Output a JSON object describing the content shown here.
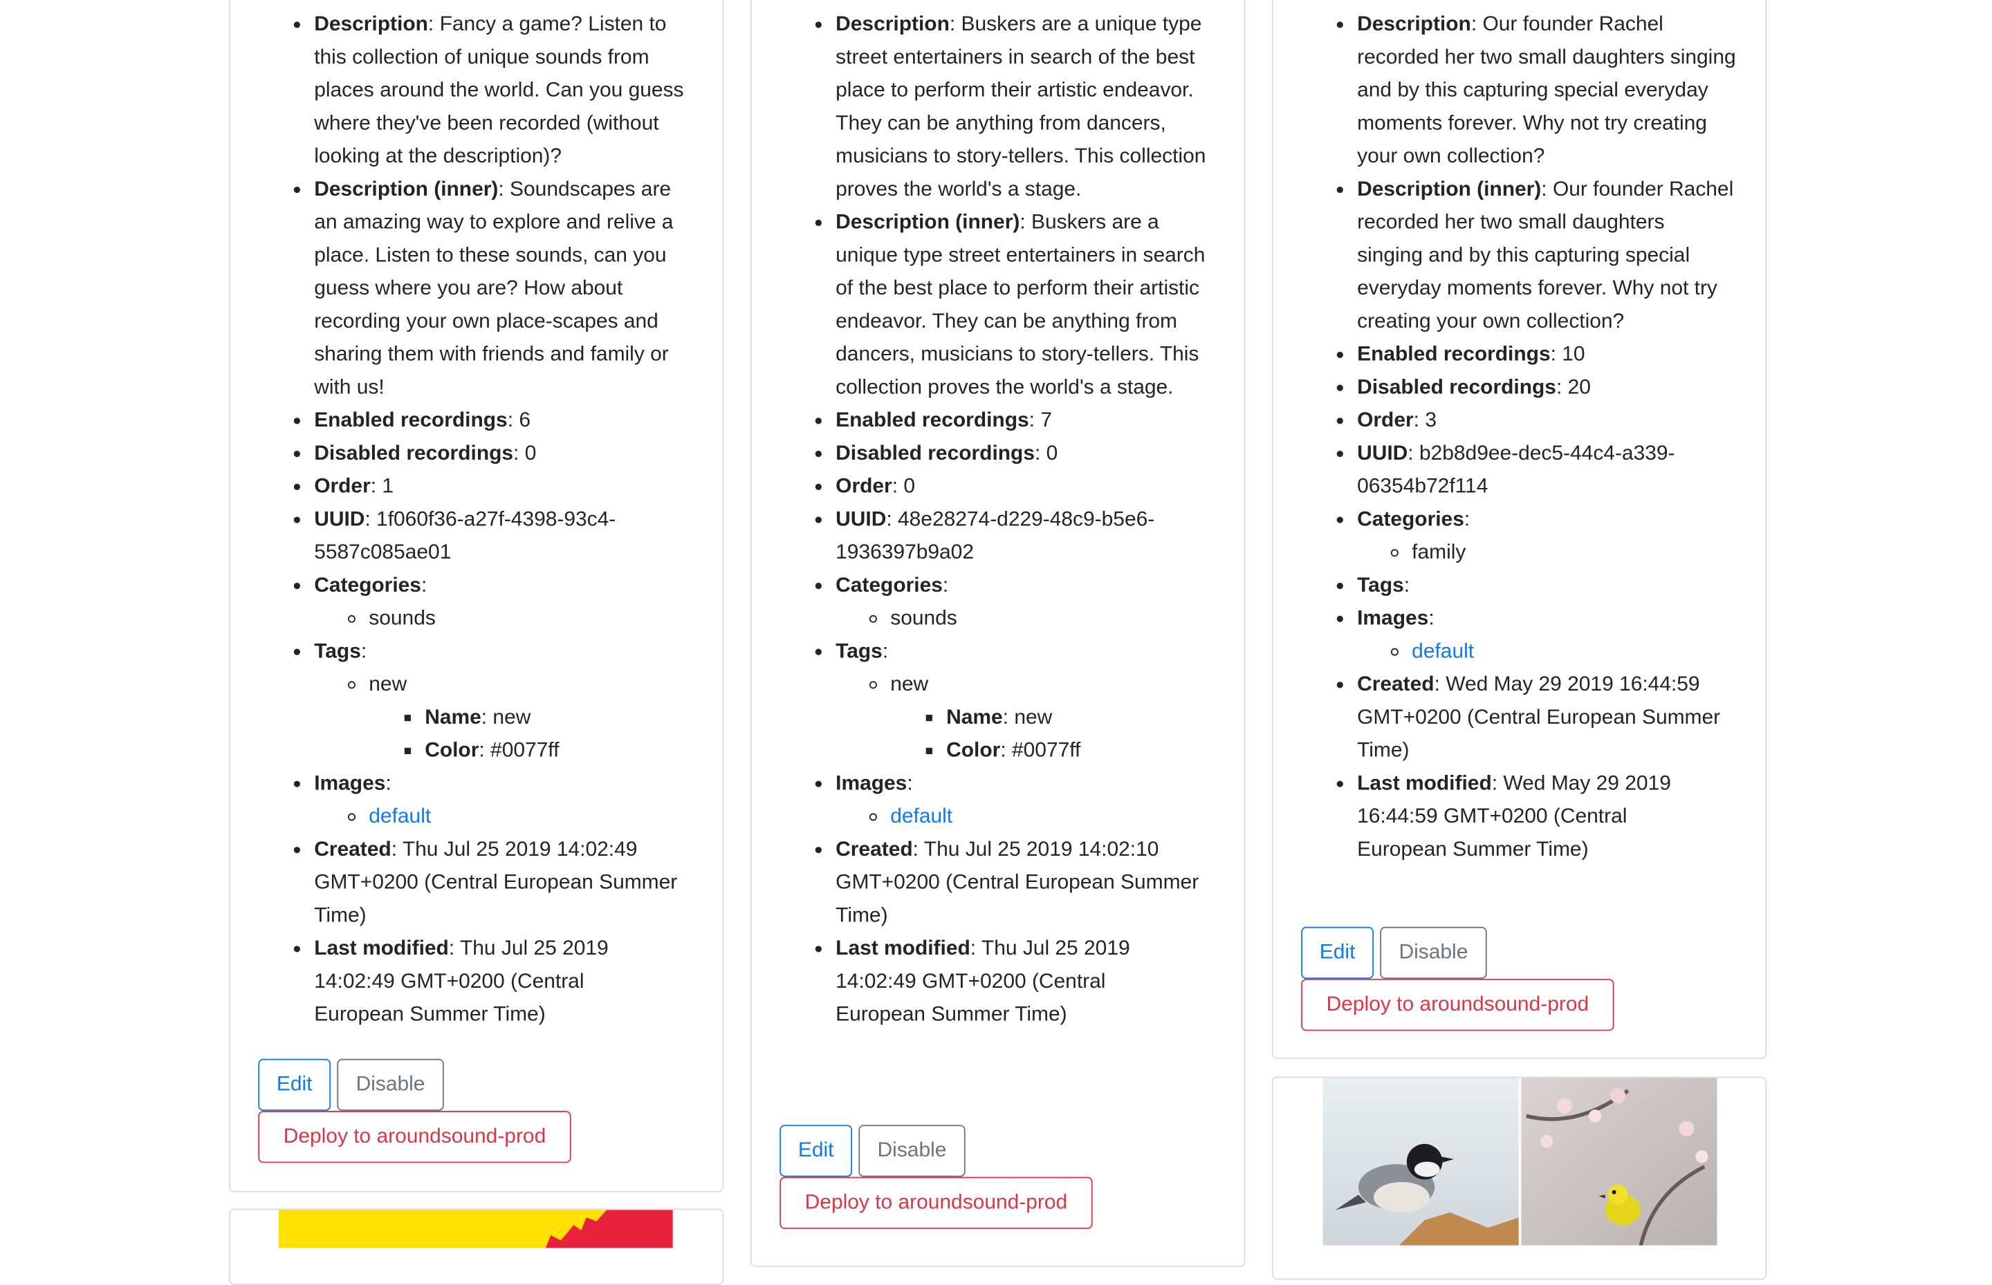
{
  "labels": {
    "description": "Description",
    "description_inner": "Description (inner)",
    "enabled": "Enabled recordings",
    "disabled": "Disabled recordings",
    "order": "Order",
    "uuid": "UUID",
    "categories": "Categories",
    "tags": "Tags",
    "name": "Name",
    "color": "Color",
    "images": "Images",
    "created": "Created",
    "modified": "Last modified"
  },
  "buttons": {
    "edit": "Edit",
    "disable": "Disable",
    "deploy": "Deploy to aroundsound-prod"
  },
  "cards": [
    {
      "description": "Fancy a game? Listen to this collection of unique sounds from places around the world. Can you guess where they've been recorded (without looking at the description)?",
      "description_inner": "Soundscapes are an amazing way to explore and relive a place. Listen to these sounds, can you guess where you are? How about recording your own place-scapes and sharing them with friends and family or with us!",
      "enabled": "6",
      "disabled": "0",
      "order": "1",
      "uuid": "1f060f36-a27f-4398-93c4-5587c085ae01",
      "category": "sounds",
      "tag": "new",
      "tag_name": "new",
      "tag_color": "#0077ff",
      "image": "default",
      "created": "Thu Jul 25 2019 14:02:49 GMT+0200 (Central European Summer Time)",
      "modified": "Thu Jul 25 2019 14:02:49 GMT+0200 (Central European Summer Time)"
    },
    {
      "description": "Buskers are a unique type street entertainers in search of the best place to perform their artistic endeavor. They can be anything from dancers, musicians to story-tellers. This collection proves the world's a stage.",
      "description_inner": "Buskers are a unique type street entertainers in search of the best place to perform their artistic endeavor. They can be anything from dancers, musicians to story-tellers. This collection proves the world's a stage.",
      "enabled": "7",
      "disabled": "0",
      "order": "0",
      "uuid": "48e28274-d229-48c9-b5e6-1936397b9a02",
      "category": "sounds",
      "tag": "new",
      "tag_name": "new",
      "tag_color": "#0077ff",
      "image": "default",
      "created": "Thu Jul 25 2019 14:02:10 GMT+0200 (Central European Summer Time)",
      "modified": "Thu Jul 25 2019 14:02:49 GMT+0200 (Central European Summer Time)"
    },
    {
      "description": "Our founder Rachel recorded her two small daughters singing and by this capturing special everyday moments forever. Why not try creating your own collection?",
      "description_inner": "Our founder Rachel recorded her two small daughters singing and by this capturing special everyday moments forever. Why not try creating your own collection?",
      "enabled": "10",
      "disabled": "20",
      "order": "3",
      "uuid": "b2b8d9ee-dec5-44c4-a339-06354b72f114",
      "category": "family",
      "image": "default",
      "created": "Wed May 29 2019 16:44:59 GMT+0200 (Central European Summer Time)",
      "modified": "Wed May 29 2019 16:44:59 GMT+0200 (Central European Summer Time)"
    }
  ],
  "colors": {
    "primary": "#0d7bf0",
    "secondary": "#6c757d",
    "danger": "#dc3545",
    "thumb_yellow": "#ffe000",
    "thumb_red": "#e8223c"
  }
}
